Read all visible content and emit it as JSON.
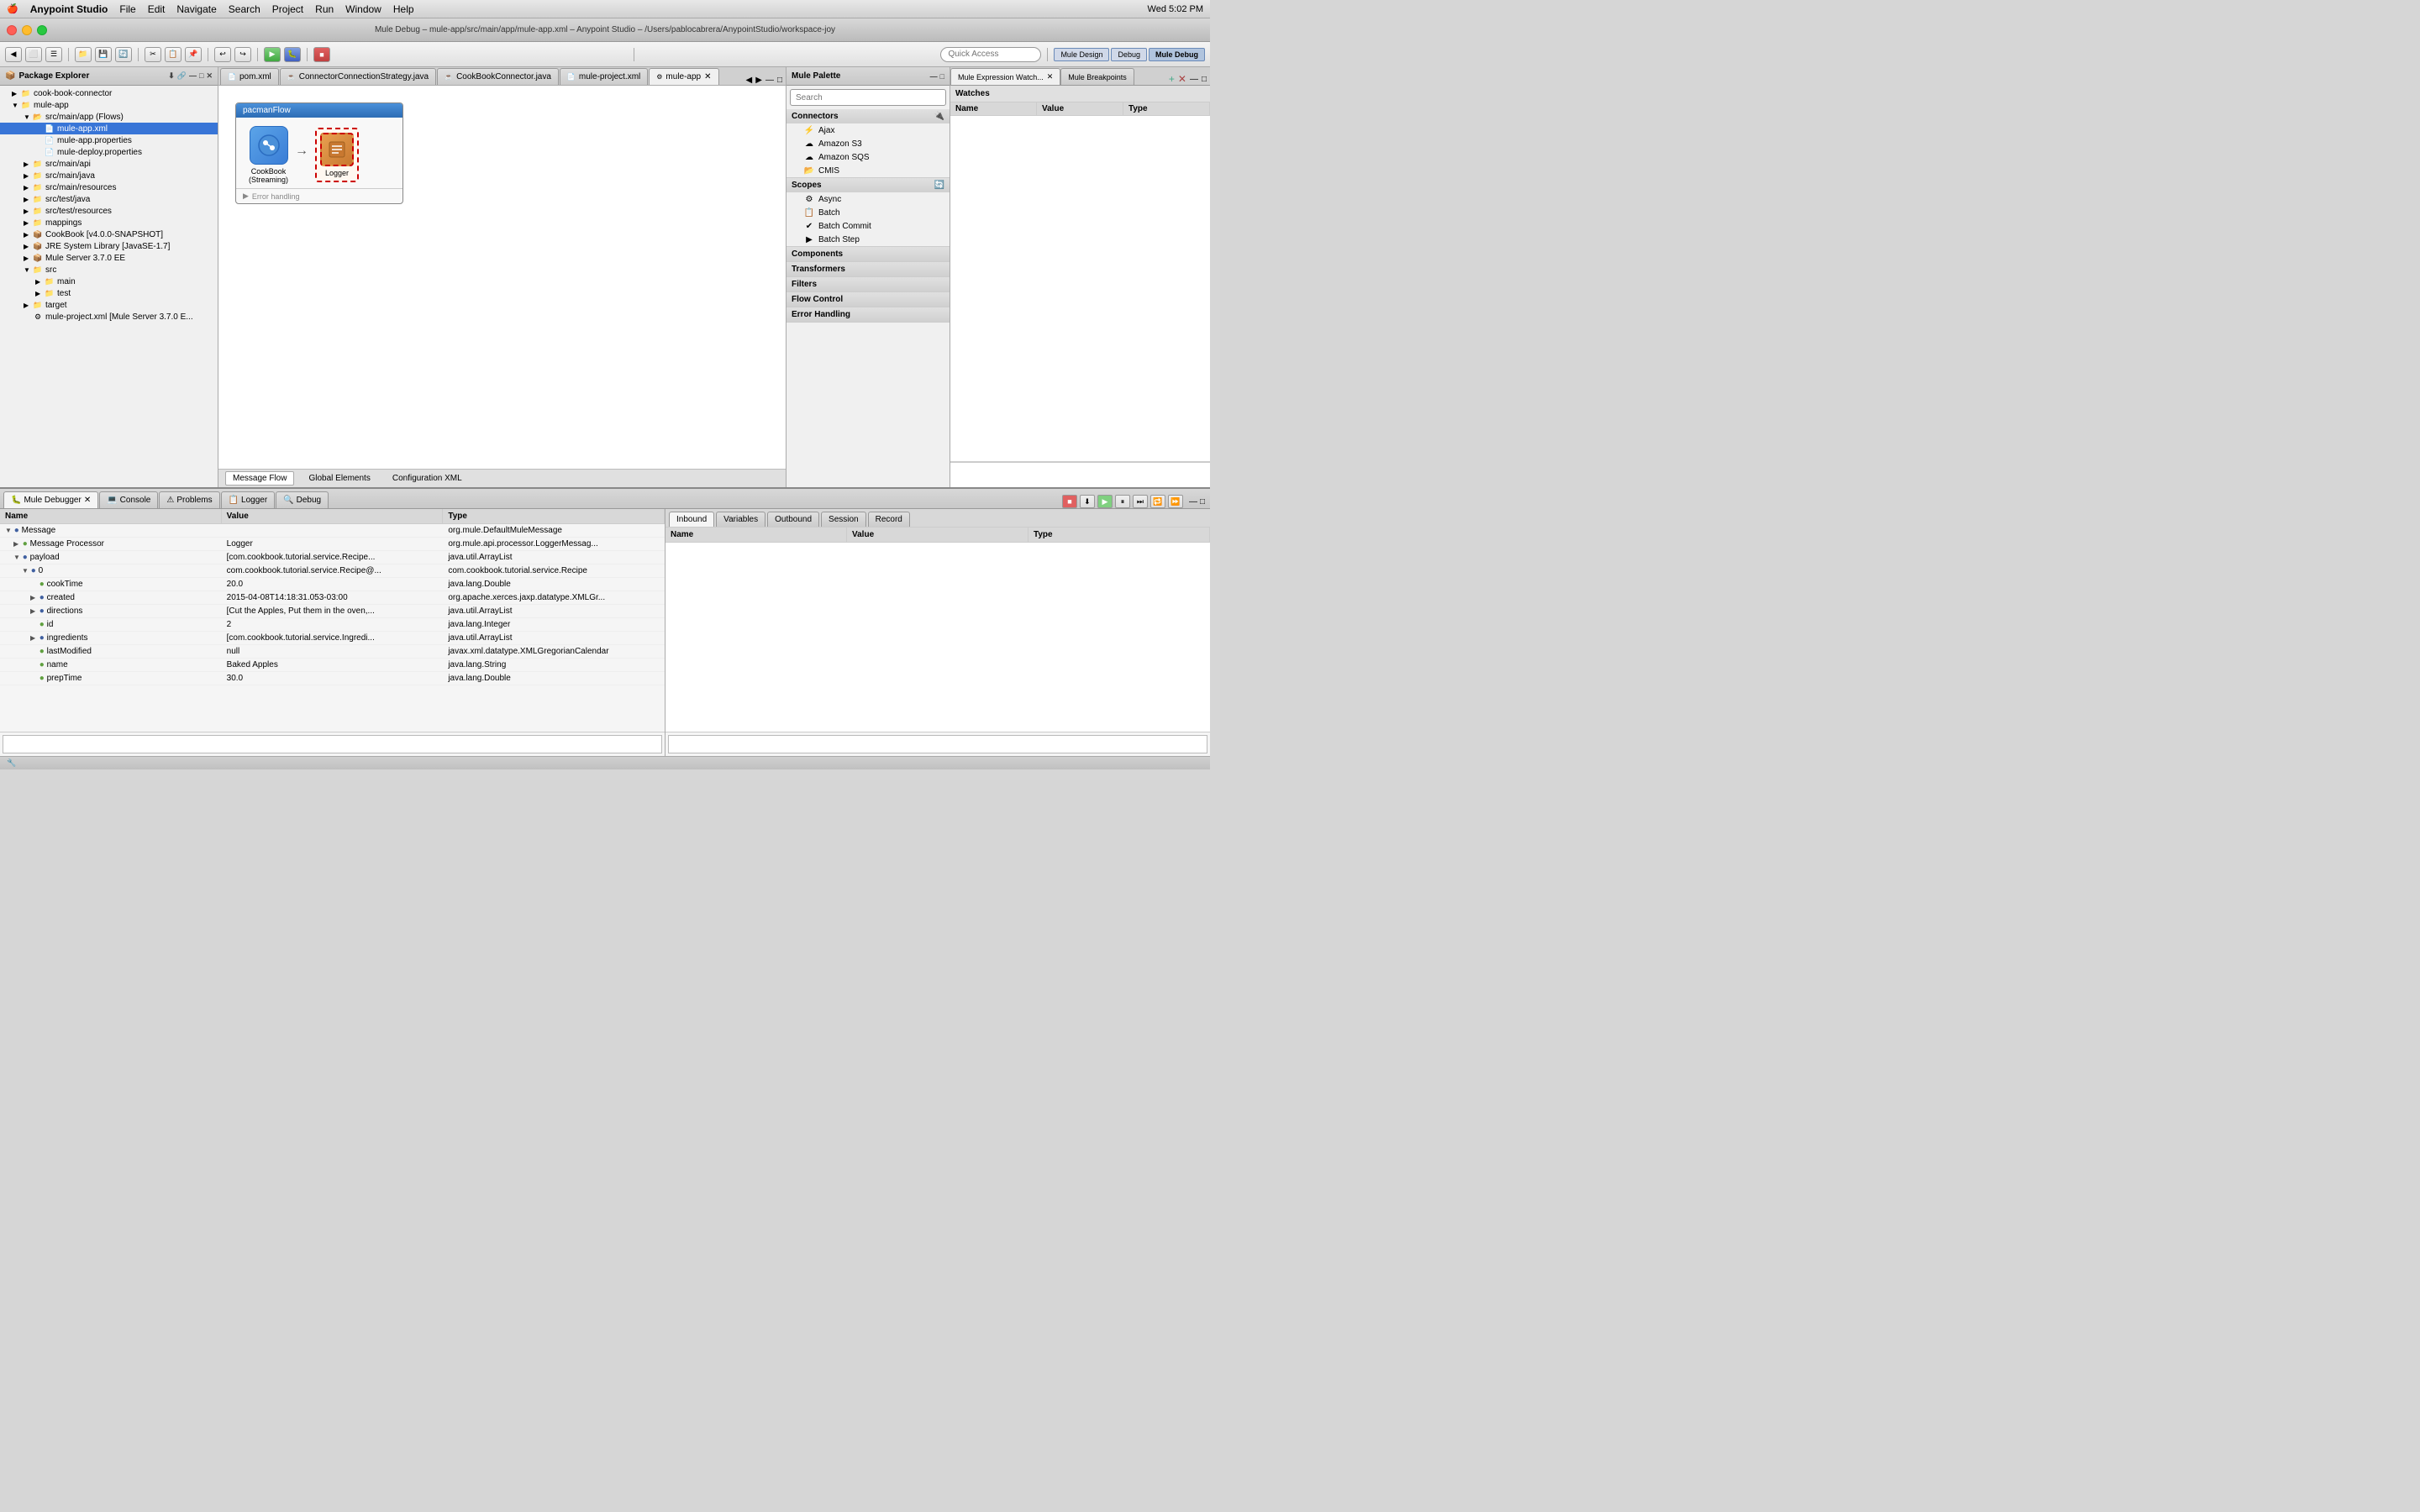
{
  "menubar": {
    "apple": "🍎",
    "app": "Anypoint Studio",
    "items": [
      "File",
      "Edit",
      "Navigate",
      "Search",
      "Project",
      "Run",
      "Window",
      "Help"
    ],
    "right": "Wed 5:02 PM"
  },
  "window_title": "Mule Debug – mule-app/src/main/app/mule-app.xml – Anypoint Studio – /Users/pablocabrera/AnypointStudio/workspace-joy",
  "quick_access_label": "Quick Access",
  "perspectives": [
    {
      "label": "Mule Design",
      "active": false
    },
    {
      "label": "Debug",
      "active": false
    },
    {
      "label": "Mule Debug",
      "active": true
    }
  ],
  "package_explorer": {
    "title": "Package Explorer",
    "items": [
      {
        "level": 0,
        "expanded": true,
        "icon": "folder",
        "label": "cook-book-connector"
      },
      {
        "level": 0,
        "expanded": true,
        "icon": "folder",
        "label": "mule-app"
      },
      {
        "level": 1,
        "expanded": true,
        "icon": "folder",
        "label": "src/main/app (Flows)"
      },
      {
        "level": 2,
        "expanded": false,
        "icon": "file-xml",
        "label": "mule-app.xml",
        "selected": true
      },
      {
        "level": 2,
        "expanded": false,
        "icon": "file-props",
        "label": "mule-app.properties"
      },
      {
        "level": 2,
        "expanded": false,
        "icon": "file-props",
        "label": "mule-deploy.properties"
      },
      {
        "level": 1,
        "expanded": false,
        "icon": "folder",
        "label": "src/main/api"
      },
      {
        "level": 1,
        "expanded": false,
        "icon": "folder",
        "label": "src/main/java"
      },
      {
        "level": 1,
        "expanded": false,
        "icon": "folder",
        "label": "src/main/resources"
      },
      {
        "level": 1,
        "expanded": false,
        "icon": "folder",
        "label": "src/test/java"
      },
      {
        "level": 1,
        "expanded": false,
        "icon": "folder",
        "label": "src/test/resources"
      },
      {
        "level": 1,
        "expanded": false,
        "icon": "folder",
        "label": "mappings"
      },
      {
        "level": 1,
        "expanded": false,
        "icon": "jar",
        "label": "CookBook [v4.0.0-SNAPSHOT]"
      },
      {
        "level": 1,
        "expanded": false,
        "icon": "jar",
        "label": "JRE System Library [JavaSE-1.7]"
      },
      {
        "level": 1,
        "expanded": false,
        "icon": "jar",
        "label": "Mule Server 3.7.0 EE"
      },
      {
        "level": 1,
        "expanded": true,
        "icon": "folder",
        "label": "src"
      },
      {
        "level": 2,
        "expanded": false,
        "icon": "folder",
        "label": "main"
      },
      {
        "level": 2,
        "expanded": false,
        "icon": "folder",
        "label": "test"
      },
      {
        "level": 1,
        "expanded": false,
        "icon": "folder",
        "label": "target"
      },
      {
        "level": 1,
        "expanded": false,
        "icon": "file-xml",
        "label": "mule-project.xml [Mule Server 3.7.0 E..."
      }
    ]
  },
  "editor_tabs": [
    {
      "label": "pom.xml",
      "icon": "xml",
      "active": false
    },
    {
      "label": "ConnectorConnectionStrategy.java",
      "icon": "java",
      "active": false
    },
    {
      "label": "CookBookConnector.java",
      "icon": "java",
      "active": false
    },
    {
      "label": "mule-project.xml",
      "icon": "xml",
      "active": false
    },
    {
      "label": "mule-app",
      "icon": "xml",
      "active": true
    }
  ],
  "flow": {
    "name": "pacmanFlow",
    "nodes": [
      {
        "type": "connector",
        "label": "CookBook\n(Streaming)",
        "icon": "🔗"
      },
      {
        "type": "logger",
        "label": "Logger",
        "icon": "📋"
      }
    ],
    "error_handling_label": "Error handling"
  },
  "canvas_bottom_tabs": [
    {
      "label": "Message Flow",
      "active": true
    },
    {
      "label": "Global Elements",
      "active": false
    },
    {
      "label": "Configuration XML",
      "active": false
    }
  ],
  "palette": {
    "search_placeholder": "Search",
    "sections": [
      {
        "label": "Connectors",
        "expanded": true,
        "items": [
          "Ajax",
          "Amazon S3",
          "Amazon SQS",
          "CMIS"
        ]
      },
      {
        "label": "Scopes",
        "expanded": true,
        "items": [
          "Async",
          "Batch",
          "Batch Commit",
          "Batch Step"
        ]
      },
      {
        "label": "Components",
        "expanded": false,
        "items": []
      },
      {
        "label": "Transformers",
        "expanded": false,
        "items": []
      },
      {
        "label": "Filters",
        "expanded": false,
        "items": []
      },
      {
        "label": "Flow Control",
        "expanded": false,
        "items": []
      },
      {
        "label": "Error Handling",
        "expanded": false,
        "items": []
      }
    ]
  },
  "expression_watch": {
    "title": "Mule Expression Watch...",
    "watches_label": "Watches",
    "columns": [
      "Name",
      "Value",
      "Type"
    ]
  },
  "breakpoints": {
    "title": "Mule Breakpoints"
  },
  "debugger": {
    "tab_label": "Mule Debugger",
    "tabs": [
      "Console",
      "Problems",
      "Logger",
      "Debug"
    ],
    "active_tab": "Mule Debugger",
    "columns": [
      "Name",
      "Value",
      "Type"
    ],
    "rows": [
      {
        "indent": 0,
        "expanded": true,
        "name": "Message",
        "value": "",
        "type": "org.mule.DefaultMuleMessage"
      },
      {
        "indent": 1,
        "expanded": false,
        "name": "Message Processor",
        "value": "Logger",
        "type": "org.mule.api.processor.LoggerMessag..."
      },
      {
        "indent": 1,
        "expanded": true,
        "name": "payload",
        "value": "[com.cookbook.tutorial.service.Recipe...",
        "type": "java.util.ArrayList"
      },
      {
        "indent": 2,
        "expanded": true,
        "name": "0",
        "value": "com.cookbook.tutorial.service.Recipe@...",
        "type": "com.cookbook.tutorial.service.Recipe"
      },
      {
        "indent": 3,
        "expanded": false,
        "name": "cookTime",
        "value": "20.0",
        "type": "java.lang.Double"
      },
      {
        "indent": 3,
        "expanded": true,
        "name": "created",
        "value": "2015-04-08T14:18:31.053-03:00",
        "type": "org.apache.xerces.jaxp.datatype.XMLGr..."
      },
      {
        "indent": 3,
        "expanded": true,
        "name": "directions",
        "value": "[Cut the Apples, Put them in the oven,...",
        "type": "java.util.ArrayList"
      },
      {
        "indent": 3,
        "expanded": false,
        "name": "id",
        "value": "2",
        "type": "java.lang.Integer"
      },
      {
        "indent": 3,
        "expanded": true,
        "name": "ingredients",
        "value": "[com.cookbook.tutorial.service.Ingredi...",
        "type": "java.util.ArrayList"
      },
      {
        "indent": 3,
        "expanded": false,
        "name": "lastModified",
        "value": "null",
        "type": "javax.xml.datatype.XMLGregorianCalendar"
      },
      {
        "indent": 3,
        "expanded": false,
        "name": "name",
        "value": "Baked Apples",
        "type": "java.lang.String"
      },
      {
        "indent": 3,
        "expanded": false,
        "name": "prepTime",
        "value": "30.0",
        "type": "java.lang.Double"
      }
    ]
  },
  "inbound": {
    "tabs": [
      "Inbound",
      "Variables",
      "Outbound",
      "Session",
      "Record"
    ],
    "active_tab": "Inbound",
    "columns": [
      "Name",
      "Value",
      "Type"
    ]
  }
}
